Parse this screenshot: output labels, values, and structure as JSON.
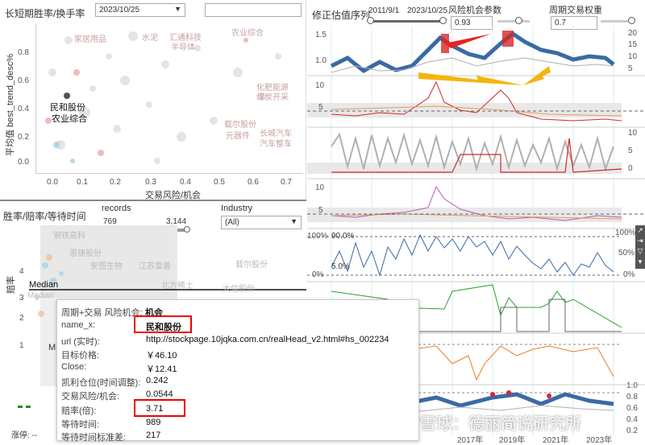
{
  "left_top": {
    "title": "长短期胜率/换手率",
    "date_value": "2023/10/25",
    "ylabel": "平均值 best_trend_desc%",
    "xlabel": "交易风险/机会",
    "yticks": [
      "0.8",
      "0.6",
      "0.4",
      "0.2",
      "0.0"
    ],
    "xticks": [
      "0.0",
      "0.1",
      "0.2",
      "0.3",
      "0.4",
      "0.5",
      "0.6",
      "0.7"
    ],
    "labels": [
      "家居用品",
      "水泥",
      "汇通科技",
      "半导体",
      "农业综合",
      "化肥能源",
      "煤炭开采",
      "载尔股份",
      "元器件",
      "长城汽车",
      "汽车整车"
    ],
    "highlight_name": "民和股份",
    "highlight_sub": "农业综合"
  },
  "left_mid": {
    "title": "胜率/赔率/等待时间",
    "records_label": "records",
    "records_min": "769",
    "records_max": "3,144",
    "industry_label": "Industry",
    "industry_value": "(All)",
    "ylabel": "赔率",
    "yticks": [
      "4",
      "3",
      "2",
      "1"
    ],
    "median_label": "Median",
    "median_label2": "Median",
    "labels": [
      "钢铁高科",
      "恩捷股份",
      "安图生物",
      "江苏雷善",
      "北方稀土",
      "载尔股份",
      "大信股份"
    ],
    "footer": "涨停: --",
    "footer2": "M"
  },
  "right": {
    "title": "修正估值序列",
    "start_date": "2011/9/1",
    "end_date": "2023/10/25",
    "risk_label": "风险机会参数",
    "risk_value": "0.93",
    "cycle_label": "周期交易权重",
    "cycle_value": "0.7",
    "panel1_left_ticks": [
      "1.5",
      "1.0"
    ],
    "panel1_right_ticks": [
      "20",
      "15",
      "10",
      "5"
    ],
    "panel2_ticks": [
      "10",
      "5"
    ],
    "panel3_right_ticks": [
      "10",
      "5",
      "0"
    ],
    "panel4_ticks": [
      "10",
      "5"
    ],
    "panel5_ticks": [
      "100%",
      "0%"
    ],
    "panel5_right_ticks": [
      "100%",
      "50%",
      "0%"
    ],
    "panel5_labels": [
      "90.0%",
      "5.0%"
    ],
    "panel6_right_ticks": [
      "1.0",
      "0.8",
      "0.6",
      "0.4",
      "0.2"
    ],
    "year_labels": [
      "2017年",
      "2019年",
      "2021年",
      "2023年"
    ],
    "watermark": "雪球：德丽简说研究所"
  },
  "tooltip": {
    "rows": [
      {
        "label": "周期+交易 风险机会:",
        "value": "机会"
      },
      {
        "label": "name_x:",
        "value": "民和股份"
      },
      {
        "label": "url (实时):",
        "value": "http://stockpage.10jqka.com.cn/realHead_v2.html#hs_002234"
      },
      {
        "label": "目标价格:",
        "value": "￥46.10"
      },
      {
        "label": "Close:",
        "value": "￥12.41"
      },
      {
        "label": "凯利仓位(时间调整):",
        "value": "0.242"
      },
      {
        "label": "交易风险/机会:",
        "value": "0.0544"
      },
      {
        "label": "赔率(倍):",
        "value": "3.71"
      },
      {
        "label": "等待时间:",
        "value": "989"
      },
      {
        "label": "等待时间标准差:",
        "value": "217"
      }
    ]
  },
  "colors": {
    "blue": "#3a6aa5",
    "red": "#d62728",
    "orange": "#f5a623",
    "gray": "#b0b0b0",
    "green": "#2ca02c"
  }
}
